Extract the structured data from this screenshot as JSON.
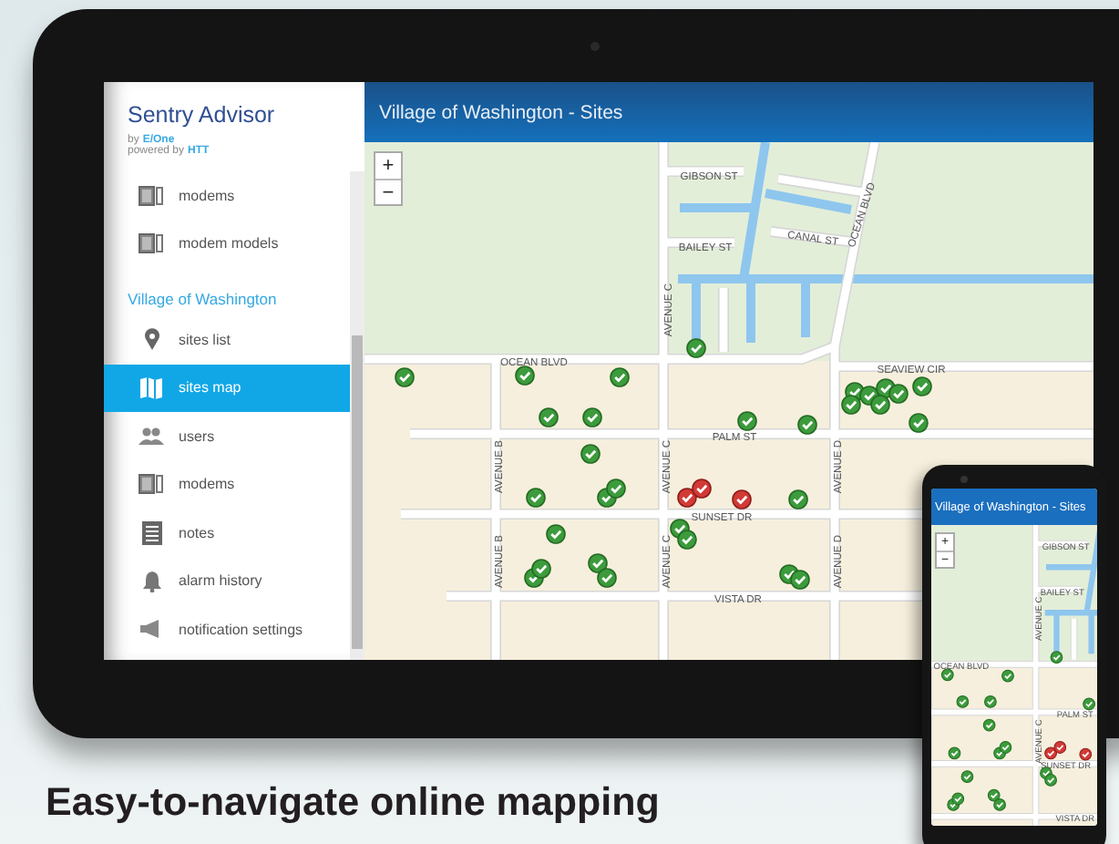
{
  "tablet": {
    "sidebar": {
      "title": "Sentry Advisor",
      "byline": {
        "prefix": "by",
        "brand": "E/One"
      },
      "powered": {
        "prefix": "powered by",
        "brand": "HTT"
      },
      "items": [
        {
          "kind": "item",
          "label": "modems",
          "selected": false
        },
        {
          "kind": "item",
          "label": "modem models",
          "selected": false
        },
        {
          "kind": "section",
          "label": "Village of Washington",
          "selected": false
        },
        {
          "kind": "item",
          "label": "sites list",
          "selected": false
        },
        {
          "kind": "item",
          "label": "sites map",
          "selected": true
        },
        {
          "kind": "item",
          "label": "users",
          "selected": false
        },
        {
          "kind": "item",
          "label": "modems",
          "selected": false
        },
        {
          "kind": "item",
          "label": "notes",
          "selected": false
        },
        {
          "kind": "item",
          "label": "alarm history",
          "selected": false
        },
        {
          "kind": "item",
          "label": "notification settings",
          "selected": false
        }
      ]
    },
    "map": {
      "title": "Village of Washington - Sites",
      "zoom_in": "+",
      "zoom_out": "−",
      "street_labels": [
        "GIBSON ST",
        "BAILEY ST",
        "CANAL ST",
        "OCEAN BLVD",
        "AVENUE C",
        "OCEAN BLVD",
        "SEAVIEW CIR",
        "AVENUE B",
        "AVENUE C",
        "PALM ST",
        "AVENUE D",
        "SUNSET DR",
        "AVENUE B",
        "AVENUE C",
        "AVENUE D",
        "VISTA DR"
      ],
      "markers": [
        {
          "alarm": false
        },
        {
          "alarm": false
        },
        {
          "alarm": false
        },
        {
          "alarm": false
        },
        {
          "alarm": false
        },
        {
          "alarm": false
        },
        {
          "alarm": false
        },
        {
          "alarm": false
        },
        {
          "alarm": false
        },
        {
          "alarm": false
        },
        {
          "alarm": false
        },
        {
          "alarm": false
        },
        {
          "alarm": true
        },
        {
          "alarm": true
        },
        {
          "alarm": true
        },
        {
          "alarm": false
        },
        {
          "alarm": false
        },
        {
          "alarm": false
        },
        {
          "alarm": false
        },
        {
          "alarm": false
        },
        {
          "alarm": false
        },
        {
          "alarm": false
        },
        {
          "alarm": false
        },
        {
          "alarm": false
        },
        {
          "alarm": false
        },
        {
          "alarm": false
        },
        {
          "alarm": false
        },
        {
          "alarm": false
        },
        {
          "alarm": false
        },
        {
          "alarm": false
        },
        {
          "alarm": false
        },
        {
          "alarm": false
        },
        {
          "alarm": false
        }
      ]
    }
  },
  "phone": {
    "map": {
      "title": "Village of Washington - Sites",
      "zoom_in": "+",
      "zoom_out": "−",
      "street_labels": [
        "GIBSON ST",
        "BAILEY ST",
        "AVENUE C",
        "OCEAN BLVD",
        "PALM ST",
        "AVENUE C",
        "SUNSET DR",
        "VISTA DR"
      ],
      "markers": [
        {
          "alarm": false
        },
        {
          "alarm": false
        },
        {
          "alarm": false
        },
        {
          "alarm": false
        },
        {
          "alarm": false
        },
        {
          "alarm": false
        },
        {
          "alarm": false
        },
        {
          "alarm": false
        },
        {
          "alarm": false
        },
        {
          "alarm": false
        },
        {
          "alarm": true
        },
        {
          "alarm": true
        },
        {
          "alarm": true
        },
        {
          "alarm": false
        },
        {
          "alarm": false
        },
        {
          "alarm": false
        },
        {
          "alarm": false
        },
        {
          "alarm": false
        },
        {
          "alarm": false
        },
        {
          "alarm": false
        }
      ]
    }
  },
  "caption": "Easy-to-navigate online mapping"
}
